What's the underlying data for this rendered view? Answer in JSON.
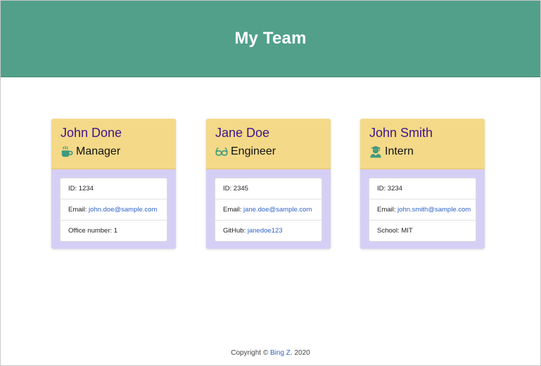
{
  "header": {
    "title": "My Team"
  },
  "colors": {
    "header_bg": "#52a08a",
    "card_head_bg": "#f4d988",
    "card_body_bg": "#d6cff5",
    "name_color": "#3e148c",
    "link_color": "#2f63c9",
    "icon_color": "#3f9a7e"
  },
  "cards": [
    {
      "name": "John Done",
      "role": "Manager",
      "icon": "coffee-icon",
      "id_label": "ID:",
      "id_value": "1234",
      "email_label": "Email:",
      "email": "john.doe@sample.com",
      "extra_label": "Office number:",
      "extra_value": "1"
    },
    {
      "name": "Jane Doe",
      "role": "Engineer",
      "icon": "glasses-icon",
      "id_label": "ID:",
      "id_value": "2345",
      "email_label": "Email:",
      "email": "jane.doe@sample.com",
      "extra_label": "GitHub:",
      "extra_value": "janedoe123"
    },
    {
      "name": "John Smith",
      "role": "Intern",
      "icon": "graduate-icon",
      "id_label": "ID:",
      "id_value": "3234",
      "email_label": "Email:",
      "email": "john.smith@sample.com",
      "extra_label": "School:",
      "extra_value": "MIT"
    }
  ],
  "footer": {
    "prefix": "Copyright ©",
    "author": "Bing Z.",
    "year": "2020"
  }
}
